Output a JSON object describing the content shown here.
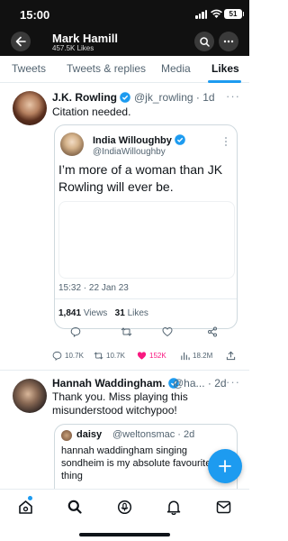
{
  "status_bar": {
    "time": "15:00",
    "battery": "51"
  },
  "header": {
    "name": "Mark Hamill",
    "subtitle": "457.5K Likes"
  },
  "tabs": [
    {
      "label": "Tweets",
      "active": false
    },
    {
      "label": "Tweets & replies",
      "active": false
    },
    {
      "label": "Media",
      "active": false
    },
    {
      "label": "Likes",
      "active": true
    }
  ],
  "tweet1": {
    "name": "J.K. Rowling",
    "handle": "@jk_rowling · 1d",
    "text": "Citation needed.",
    "quoted": {
      "name": "India Willoughby",
      "handle": "@IndiaWilloughby",
      "text": "I’m more of a woman than JK Rowling will ever be.",
      "timestamp": "15:32 · 22 Jan 23",
      "views_count": "1,841",
      "views_label": "Views",
      "likes_count": "31",
      "likes_label": "Likes"
    },
    "actions": {
      "replies": "10.7K",
      "retweets": "10.7K",
      "likes": "152K",
      "views": "18.2M"
    }
  },
  "tweet2": {
    "name": "Hannah Waddingham.",
    "handle": "@ha... · 2d",
    "text": "Thank you. Miss playing this misunderstood witchypoo!",
    "quoted": {
      "name": "daisy",
      "handle": "@weltonsmac · 2d",
      "text": "hannah waddingham singing sondheim is my absolute favourite thing"
    }
  },
  "colors": {
    "accent": "#1d9bf0",
    "like": "#f91880",
    "header_bg": "#111111"
  },
  "icons": [
    "back-arrow-icon",
    "search-icon",
    "more-icon",
    "verified-icon",
    "reply-icon",
    "retweet-icon",
    "like-icon",
    "views-icon",
    "share-icon",
    "compose-icon",
    "home-icon",
    "spaces-icon",
    "notifications-icon",
    "messages-icon"
  ]
}
